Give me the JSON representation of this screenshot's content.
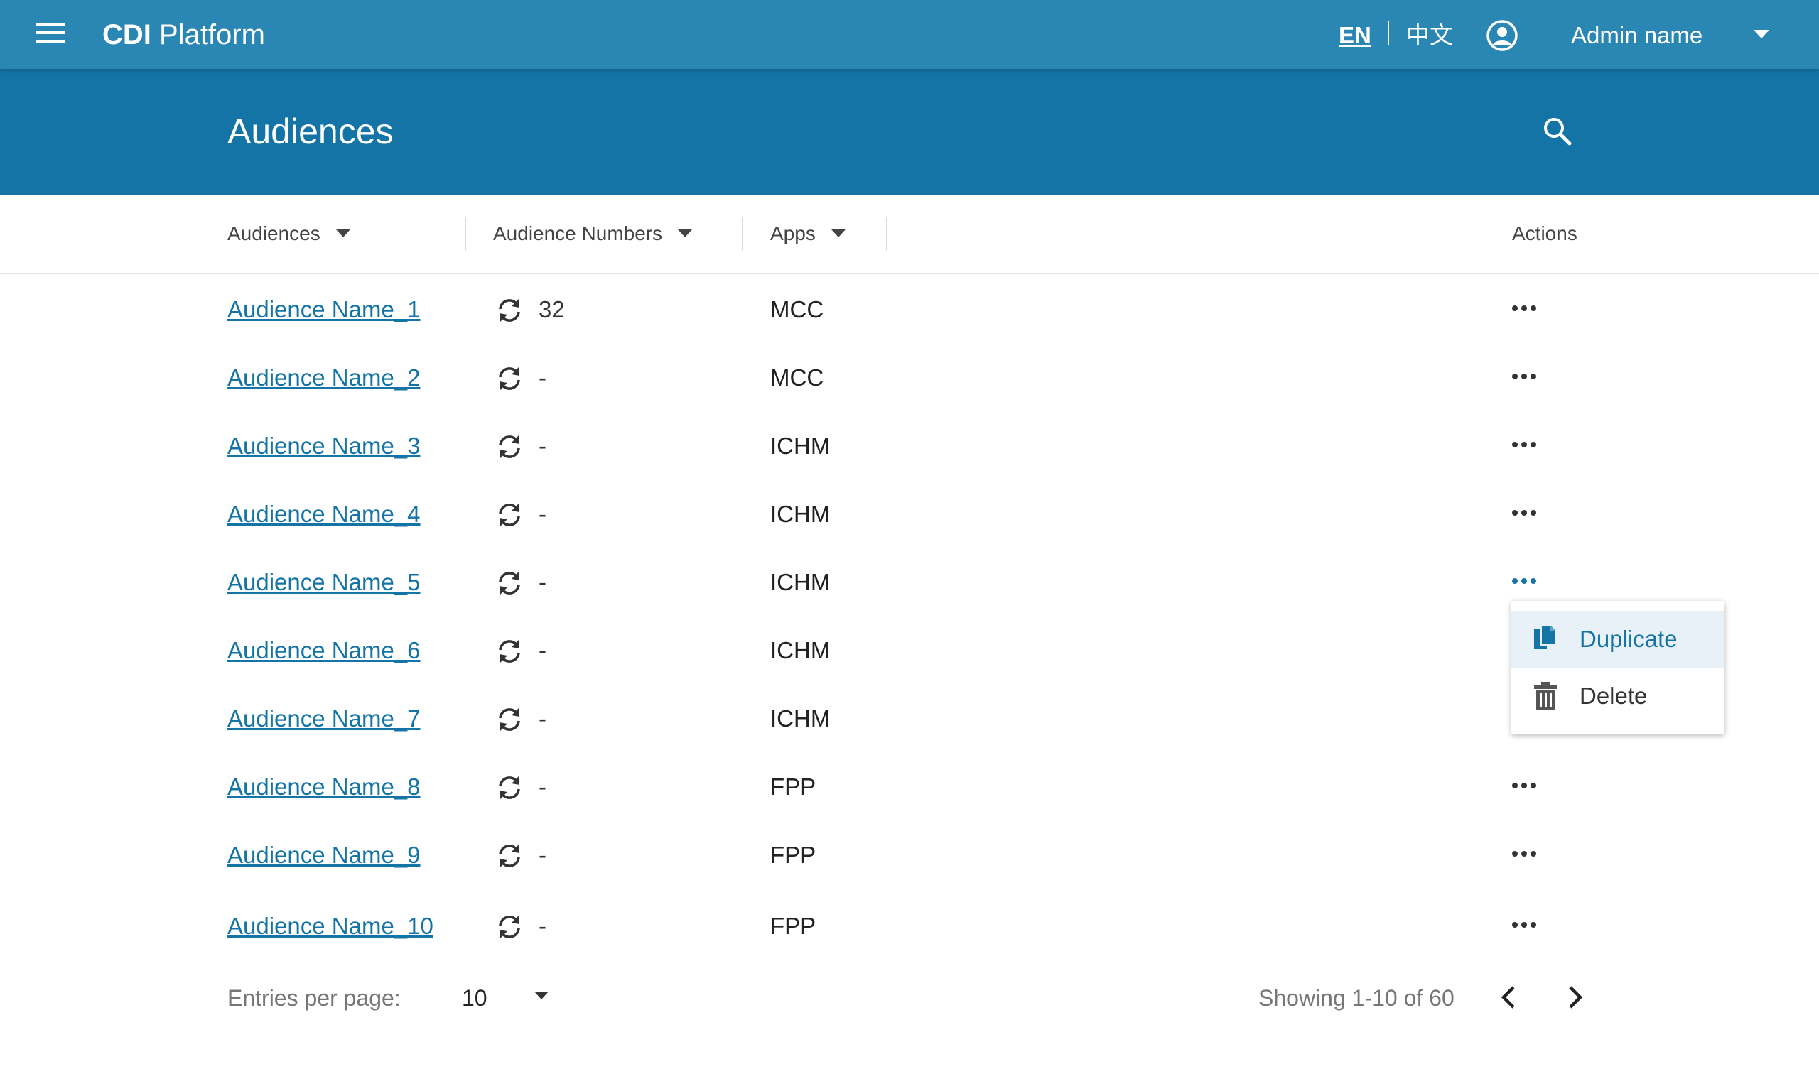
{
  "topbar": {
    "brand_bold": "CDI",
    "brand_rest": " Platform",
    "lang_en": "EN",
    "lang_zh": "中文",
    "admin_name": "Admin name"
  },
  "page": {
    "title": "Audiences"
  },
  "columns": {
    "audiences": "Audiences",
    "numbers": "Audience Numbers",
    "apps": "Apps",
    "actions": "Actions"
  },
  "rows": [
    {
      "name": "Audience Name_1",
      "number": "32",
      "app": "MCC"
    },
    {
      "name": "Audience Name_2",
      "number": "-",
      "app": "MCC"
    },
    {
      "name": "Audience Name_3",
      "number": "-",
      "app": "ICHM"
    },
    {
      "name": "Audience Name_4",
      "number": "-",
      "app": "ICHM"
    },
    {
      "name": "Audience Name_5",
      "number": "-",
      "app": "ICHM"
    },
    {
      "name": "Audience Name_6",
      "number": "-",
      "app": "ICHM"
    },
    {
      "name": "Audience Name_7",
      "number": "-",
      "app": "ICHM"
    },
    {
      "name": "Audience Name_8",
      "number": "-",
      "app": "FPP"
    },
    {
      "name": "Audience Name_9",
      "number": "-",
      "app": "FPP"
    },
    {
      "name": "Audience Name_10",
      "number": "-",
      "app": "FPP"
    }
  ],
  "menu": {
    "duplicate": "Duplicate",
    "delete": "Delete"
  },
  "footer": {
    "entries_label": "Entries per page:",
    "per_page_value": "10",
    "showing": "Showing 1-10 of 60"
  },
  "colors": {
    "topbar": "#2a86b3",
    "header": "#1474a6",
    "link": "#1474a6",
    "menu_highlight": "#e8f1f7"
  }
}
